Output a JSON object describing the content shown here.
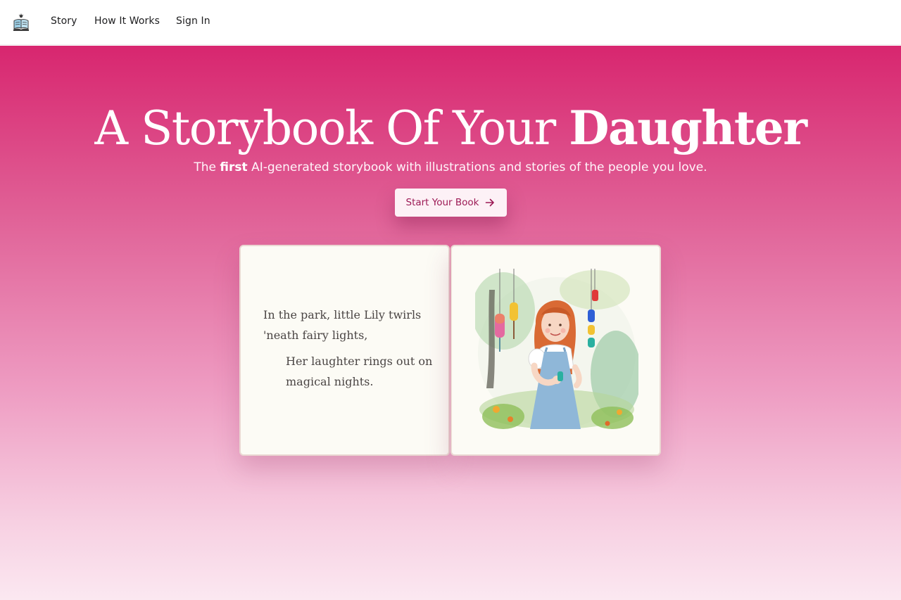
{
  "nav": {
    "logo_icon": "open-book-icon",
    "items": [
      {
        "label": "Story"
      },
      {
        "label": "How It Works"
      },
      {
        "label": "Sign In"
      }
    ]
  },
  "hero": {
    "title_light": "A Storybook Of Your",
    "title_bold": "Daughter",
    "subtitle_pre": "The",
    "subtitle_bold": "first",
    "subtitle_post": "AI-generated storybook with illustrations and stories of the people you love.",
    "cta_label": "Start Your Book",
    "cta_icon": "arrow-right-icon"
  },
  "book": {
    "verse_1": "In the park, little Lily twirls 'neath fairy lights,",
    "verse_2": "Her laughter rings out on magical nights.",
    "illustration": "watercolor-girl-with-wind-chimes"
  },
  "colors": {
    "brand": "#d8266f",
    "cta_text": "#9c1a55",
    "page_bg": "#fcfbf5"
  }
}
